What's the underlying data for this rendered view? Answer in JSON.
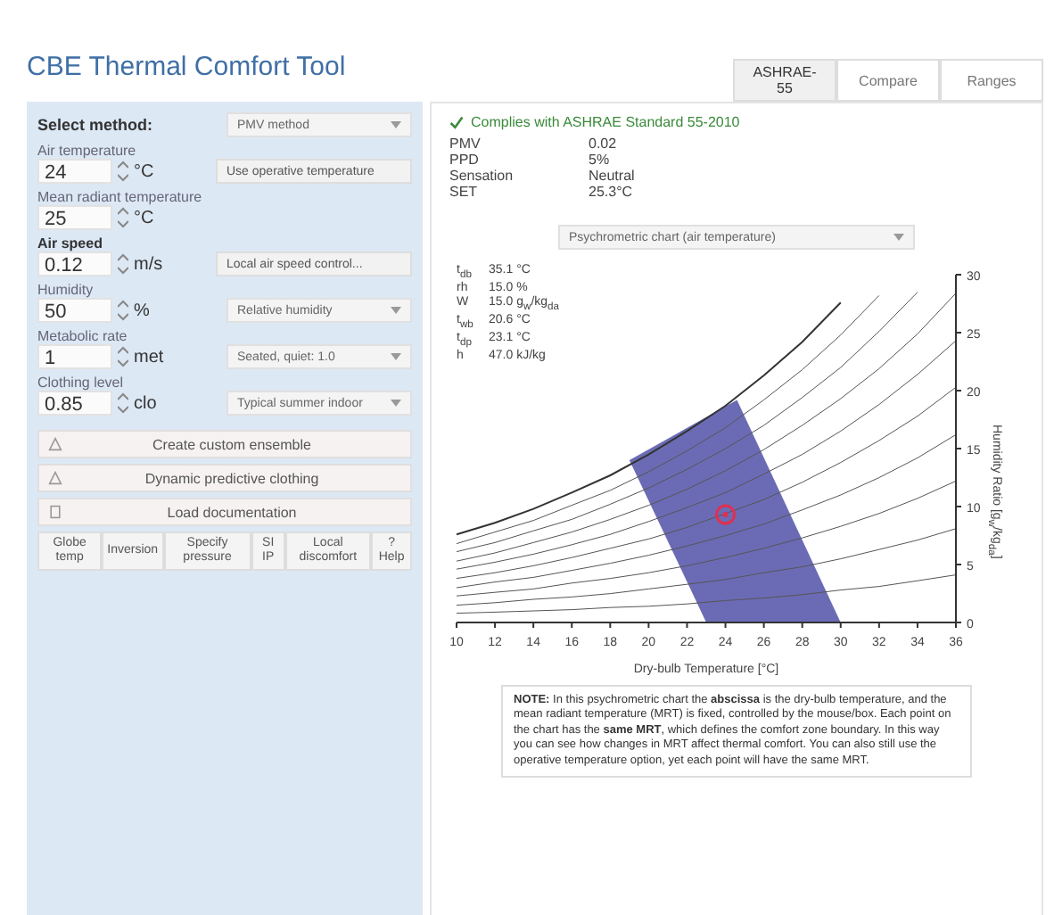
{
  "title": "CBE Thermal Comfort Tool",
  "tabs": [
    {
      "label": "ASHRAE-55",
      "selected": true
    },
    {
      "label": "Compare",
      "selected": false
    },
    {
      "label": "Ranges",
      "selected": false
    }
  ],
  "method": {
    "label": "Select method:",
    "value": "PMV method"
  },
  "inputs": [
    {
      "label": "Air temperature",
      "value": "24",
      "unit": "°C",
      "bold": false,
      "side": {
        "kind": "button",
        "text": "Use operative temperature"
      }
    },
    {
      "label": "Mean radiant temperature",
      "value": "25",
      "unit": "°C",
      "bold": false
    },
    {
      "label": "Air speed",
      "value": "0.12",
      "unit": "m/s",
      "bold": true,
      "side": {
        "kind": "button",
        "text": "Local air speed control..."
      }
    },
    {
      "label": "Humidity",
      "value": "50",
      "unit": "%",
      "bold": false,
      "side": {
        "kind": "select",
        "text": "Relative humidity"
      }
    },
    {
      "label": "Metabolic rate",
      "value": "1",
      "unit": "met",
      "bold": false,
      "side": {
        "kind": "select",
        "text": "Seated, quiet: 1.0"
      }
    },
    {
      "label": "Clothing level",
      "value": "0.85",
      "unit": "clo",
      "bold": false,
      "side": {
        "kind": "select",
        "text": "Typical summer indoor"
      }
    }
  ],
  "sections": [
    {
      "label": "Create custom ensemble",
      "kind": "warning"
    },
    {
      "label": "Dynamic predictive clothing",
      "kind": "warning"
    },
    {
      "label": "Load documentation",
      "kind": "doc"
    }
  ],
  "tool_buttons": [
    "Globe temp",
    "Inversion",
    "Specify pressure",
    "SI IP",
    "Local discomfort",
    "? Help"
  ],
  "compliance": "Complies with ASHRAE Standard 55-2010",
  "results": [
    {
      "name": "PMV",
      "value": "0.02"
    },
    {
      "name": "PPD",
      "value": "5%"
    },
    {
      "name": "Sensation",
      "value": "Neutral"
    },
    {
      "name": "SET",
      "value": "25.3°C"
    }
  ],
  "chart_select": "Psychrometric chart (air temperature)",
  "readouts": [
    {
      "name": "t$_{db}$",
      "value": "35.1 °C"
    },
    {
      "name": "rh",
      "value": "15.0 %"
    },
    {
      "name": "W",
      "value": "15.0 g$_{w}$/kg$_{da}$"
    },
    {
      "name": "t$_{wb}$",
      "value": "20.6 °C"
    },
    {
      "name": "t$_{dp}$",
      "value": "23.1 °C"
    },
    {
      "name": "h",
      "value": "47.0 kJ/kg"
    }
  ],
  "chart_data": {
    "type": "line",
    "xlabel": "Dry-bulb Temperature [°C]",
    "ylabel": "Humidity Ratio [g$_{w}$/kg$_{da}$]",
    "xlim": [
      10,
      36
    ],
    "ylim": [
      0,
      30
    ],
    "xticks": [
      10,
      12,
      14,
      16,
      18,
      20,
      22,
      24,
      26,
      28,
      30,
      32,
      34,
      36
    ],
    "yticks": [
      0,
      5,
      10,
      15,
      20,
      25,
      30
    ],
    "x": [
      10,
      12,
      14,
      16,
      18,
      20,
      22,
      24,
      26,
      28,
      30,
      32,
      34,
      36
    ],
    "series": [
      {
        "color": "#333333",
        "values": [
          7.6,
          8.6,
          9.8,
          11.2,
          12.7,
          14.5,
          16.5,
          18.7,
          21.3,
          24.2,
          27.6,
          null,
          null,
          null
        ]
      },
      {
        "color": "#555555",
        "values": [
          6.8,
          7.8,
          8.8,
          10.1,
          11.4,
          13.0,
          14.8,
          16.8,
          19.2,
          21.8,
          24.8,
          28.2,
          null,
          null
        ]
      },
      {
        "color": "#555555",
        "values": [
          6.1,
          6.9,
          7.9,
          8.9,
          10.2,
          11.6,
          13.2,
          15.0,
          17.0,
          19.4,
          22.0,
          25.1,
          28.5,
          null
        ]
      },
      {
        "color": "#555555",
        "values": [
          5.3,
          6.0,
          6.9,
          7.8,
          8.9,
          10.1,
          11.5,
          13.1,
          14.9,
          17.0,
          19.3,
          21.9,
          24.9,
          28.4
        ]
      },
      {
        "color": "#555555",
        "values": [
          4.6,
          5.2,
          5.9,
          6.7,
          7.6,
          8.7,
          9.9,
          11.2,
          12.8,
          14.5,
          16.5,
          18.8,
          21.4,
          24.3
        ]
      },
      {
        "color": "#555555",
        "values": [
          3.8,
          4.3,
          4.9,
          5.6,
          6.4,
          7.2,
          8.2,
          9.4,
          10.6,
          12.1,
          13.8,
          15.7,
          17.8,
          20.3
        ]
      },
      {
        "color": "#555555",
        "values": [
          3.0,
          3.5,
          3.9,
          4.5,
          5.1,
          5.8,
          6.6,
          7.5,
          8.5,
          9.7,
          11.0,
          12.5,
          14.2,
          16.2
        ]
      },
      {
        "color": "#555555",
        "values": [
          2.3,
          2.6,
          2.9,
          3.4,
          3.8,
          4.3,
          4.9,
          5.6,
          6.4,
          7.3,
          8.3,
          9.4,
          10.7,
          12.2
        ]
      },
      {
        "color": "#555555",
        "values": [
          1.5,
          1.7,
          2.0,
          2.2,
          2.5,
          2.9,
          3.3,
          3.7,
          4.3,
          4.8,
          5.5,
          6.3,
          7.1,
          8.1
        ]
      },
      {
        "color": "#555555",
        "values": [
          0.8,
          0.9,
          1.0,
          1.1,
          1.3,
          1.4,
          1.6,
          1.9,
          2.1,
          2.4,
          2.8,
          3.1,
          3.6,
          4.1
        ]
      }
    ]
  },
  "note": "**NOTE:** In this psychrometric chart the **abscissa** is the dry-bulb temperature, and the mean radiant temperature (MRT) is fixed, controlled by the mouse/box. Each point on the chart has the **same MRT**, which defines the comfort zone boundary. In this way you can see how changes in MRT affect thermal comfort. You can also still use the operative temperature option, yet each point will have the same MRT."
}
